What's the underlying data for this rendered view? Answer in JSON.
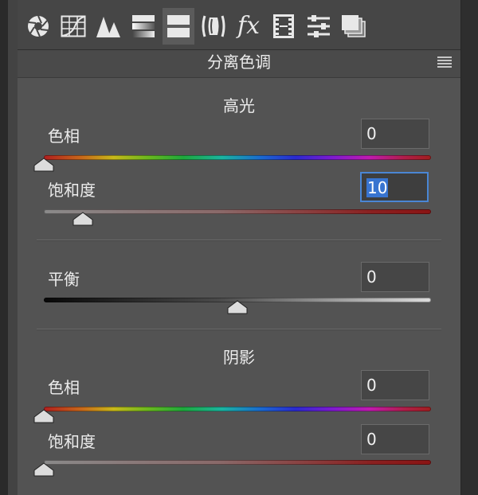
{
  "toolbar": {
    "tools": [
      {
        "icon": "aperture-icon",
        "label": "基本"
      },
      {
        "icon": "tone-curve-icon",
        "label": "色调曲线"
      },
      {
        "icon": "detail-icon",
        "label": "细节"
      },
      {
        "icon": "hsl-icon",
        "label": "HSL/灰度"
      },
      {
        "icon": "split-toning-icon",
        "label": "分离色调",
        "active": true
      },
      {
        "icon": "lens-icon",
        "label": "镜头校正"
      },
      {
        "icon": "fx-icon",
        "label": "效果"
      },
      {
        "icon": "camera-calibration-icon",
        "label": "相机校准"
      },
      {
        "icon": "presets-icon",
        "label": "预设"
      },
      {
        "icon": "snapshots-icon",
        "label": "快照"
      }
    ],
    "fx_text": "fx"
  },
  "panel": {
    "title": "分离色调",
    "highlights": {
      "title": "高光",
      "hue": {
        "label": "色相",
        "value": "0",
        "fraction": 0.0
      },
      "saturation": {
        "label": "饱和度",
        "value": "10",
        "fraction": 0.1,
        "focused": true
      }
    },
    "balance": {
      "label": "平衡",
      "value": "0",
      "fraction": 0.5
    },
    "shadows": {
      "title": "阴影",
      "hue": {
        "label": "色相",
        "value": "0",
        "fraction": 0.0
      },
      "saturation": {
        "label": "饱和度",
        "value": "0",
        "fraction": 0.0
      }
    }
  },
  "colors": {
    "focus_border": "#4a86d4",
    "selection": "#3874d0",
    "panel_bg": "#535353"
  }
}
